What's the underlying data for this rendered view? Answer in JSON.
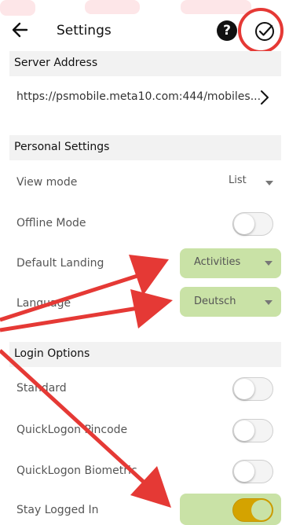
{
  "header": {
    "title": "Settings"
  },
  "sections": {
    "server": "Server Address",
    "personal": "Personal Settings",
    "login": "Login Options"
  },
  "server": {
    "url": "https://psmobile.meta10.com:444/mobiles..."
  },
  "personal": {
    "view_mode_label": "View mode",
    "view_mode_value": "List",
    "offline_label": "Offline Mode",
    "offline_on": false,
    "landing_label": "Default Landing",
    "landing_value": "Activities",
    "language_label": "Language",
    "language_value": "Deutsch"
  },
  "login": {
    "standard_label": "Standard",
    "standard_on": false,
    "pincode_label": "QuickLogon Pincode",
    "pincode_on": false,
    "biometric_label": "QuickLogon Biometric",
    "biometric_on": false,
    "stay_label": "Stay Logged In",
    "stay_on": true
  },
  "colors": {
    "accent_green": "#c9e2a6",
    "toggle_on": "#d4a300",
    "annotation_red": "#e53935"
  },
  "icons": {
    "back": "arrow-left-icon",
    "help": "question-circle-icon",
    "save": "check-circle-icon",
    "chevron": "chevron-right-icon"
  }
}
